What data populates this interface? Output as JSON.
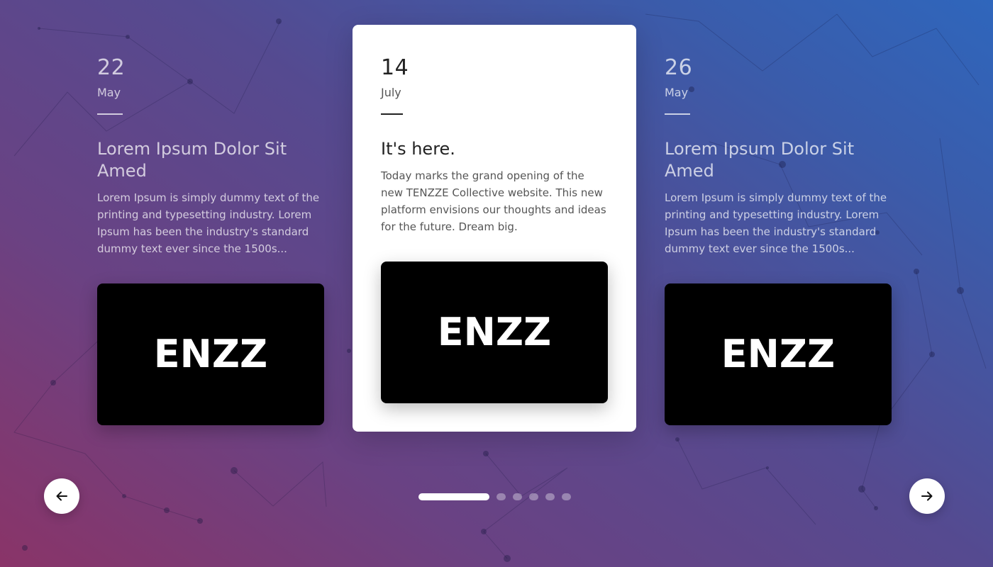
{
  "slider": {
    "slides": [
      {
        "day": "22",
        "month": "May",
        "title": "Lorem Ipsum Dolor Sit Amed",
        "text": "Lorem Ipsum is simply dummy text of the printing and typesetting industry. Lorem Ipsum has been the industry's standard dummy text ever since the 1500s...",
        "image_logo": "TENZZE"
      },
      {
        "day": "14",
        "month": "July",
        "title": "It's here.",
        "text": "Today marks the grand opening of the new TENZZE Collective website. This new platform envisions our thoughts and ideas for the future. Dream big.",
        "image_logo": "TENZZE"
      },
      {
        "day": "26",
        "month": "May",
        "title": "Lorem Ipsum Dolor Sit Amed",
        "text": "Lorem Ipsum is simply dummy text of the printing and typesetting industry. Lorem Ipsum has been the industry's standard dummy text ever since the 1500s...",
        "image_logo": "TENZZE"
      }
    ],
    "active_index": 1,
    "pagination": {
      "total": 6,
      "active": 1
    },
    "prev_button_icon": "arrow-left-icon",
    "next_button_icon": "arrow-right-icon"
  },
  "colors": {
    "background_start": "#8a3468",
    "background_end": "#2f66bc",
    "card": "#ffffff",
    "image_background": "#000000"
  }
}
